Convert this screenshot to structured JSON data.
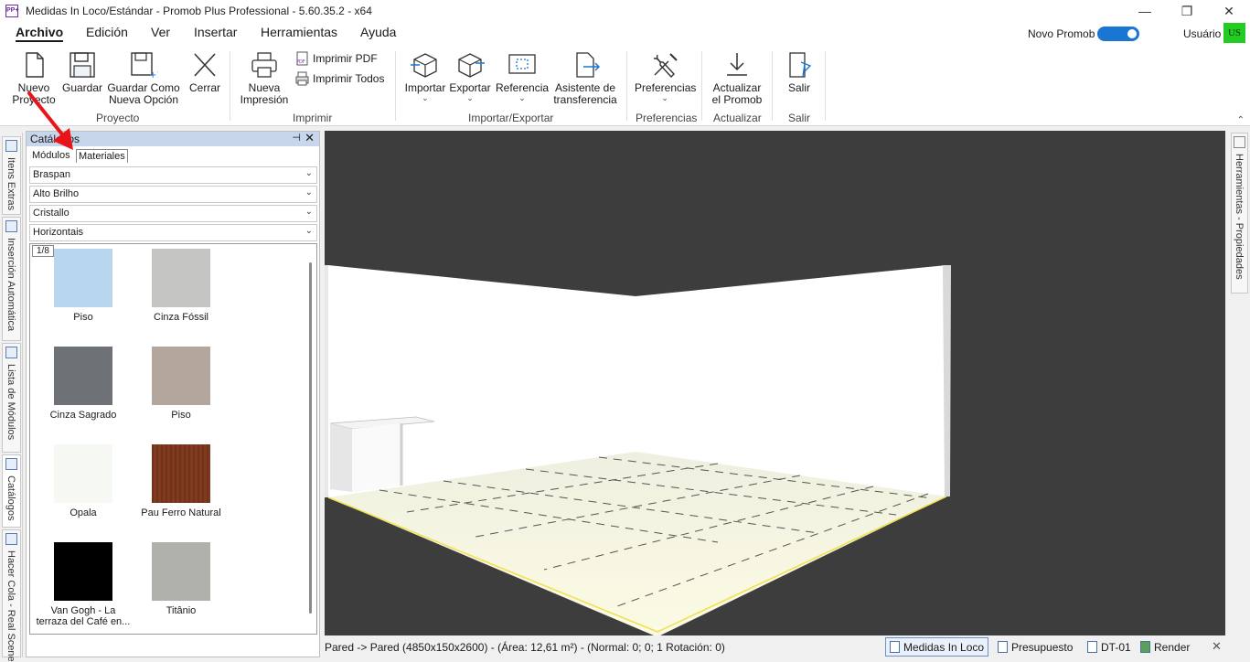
{
  "window": {
    "title": "Medidas In Loco/Estándar - Promob Plus Professional - 5.60.35.2 - x64",
    "app_icon_text": "PP+",
    "minimize": "—",
    "maximize": "❐",
    "close": "✕"
  },
  "menu": {
    "items": [
      "Archivo",
      "Edición",
      "Ver",
      "Insertar",
      "Herramientas",
      "Ayuda"
    ],
    "active": "Archivo",
    "novo_promob_label": "Novo Promob",
    "novo_promob_enabled": true,
    "user_label": "Usuário",
    "user_initials": "US"
  },
  "ribbon": {
    "groups": [
      {
        "label": "Proyecto",
        "buttons": [
          "Nuevo Proyecto",
          "Guardar",
          "Guardar Como Nueva Opción",
          "Cerrar"
        ]
      },
      {
        "label": "Imprimir",
        "buttons": [
          "Nueva Impresión"
        ],
        "small_buttons": [
          "Imprimir PDF",
          "Imprimir Todos"
        ]
      },
      {
        "label": "Importar/Exportar",
        "buttons": [
          "Importar",
          "Exportar",
          "Referencia",
          "Asistente de transferencia"
        ]
      },
      {
        "label": "Preferencias",
        "buttons": [
          "Preferencias"
        ]
      },
      {
        "label": "Actualizar",
        "buttons": [
          "Actualizar el Promob"
        ]
      },
      {
        "label": "Salir",
        "buttons": [
          "Salir"
        ]
      }
    ],
    "labels": {
      "nuevo_l1": "Nuevo",
      "nuevo_l2": "Proyecto",
      "guardar": "Guardar",
      "guardar_como_l1": "Guardar Como",
      "guardar_como_l2": "Nueva Opción",
      "cerrar": "Cerrar",
      "nueva_imp_l1": "Nueva",
      "nueva_imp_l2": "Impresión",
      "imprimir_pdf": "Imprimir PDF",
      "imprimir_todos": "Imprimir Todos",
      "importar": "Importar",
      "exportar": "Exportar",
      "referencia": "Referencia",
      "asistente_l1": "Asistente de",
      "asistente_l2": "transferencia",
      "preferencias": "Preferencias",
      "actualizar_l1": "Actualizar",
      "actualizar_l2": "el Promob",
      "salir": "Salir",
      "pdf_badge": "PDF"
    }
  },
  "left_tabs": [
    "Itens Extras",
    "Inserción Automática",
    "Lista de Módulos",
    "Catálogos",
    "Hacer Cola - Real Scene"
  ],
  "catalog": {
    "title": "Catálogos",
    "pin": "⊣",
    "close": "✕",
    "tabs": [
      "Módulos",
      "Materiales"
    ],
    "selected_tab": "Materiales",
    "filters": [
      "Braspan",
      "Alto Brilho",
      "Cristallo",
      "Horizontais"
    ],
    "page_indicator": "1/8",
    "materials": [
      {
        "name": "Piso",
        "color": "#b9d6ef"
      },
      {
        "name": "Cinza Fóssil",
        "color": "#c5c5c3"
      },
      {
        "name": "Cinza Sagrado",
        "color": "#6e7276"
      },
      {
        "name": "Piso",
        "color": "#b3a79d"
      },
      {
        "name": "Opala",
        "color": "#f6f8f3"
      },
      {
        "name": "Pau Ferro Natural",
        "color": "#7a3519"
      },
      {
        "name": "Van Gogh - La terraza del Café en...",
        "color": "#000000"
      },
      {
        "name": "Titânio",
        "color": "#b0b0ad"
      }
    ]
  },
  "right_tabs": [
    "Herramientas - Propiedades"
  ],
  "status": {
    "text": "Pared -> Pared (4850x150x2600) - (Área: 12,61 m²) - (Normal: 0; 0; 1 Rotación: 0)",
    "tabs": [
      "Medidas In Loco",
      "Presupuesto",
      "DT-01",
      "Render"
    ],
    "active_tab": "Medidas In Loco",
    "close": "✕"
  },
  "colors": {
    "accent": "#1976d2",
    "panel_header": "#c7d6ea",
    "viewport_bg": "#3d3d3d",
    "floor": "#f2f1da",
    "arrow": "#e8141a"
  }
}
